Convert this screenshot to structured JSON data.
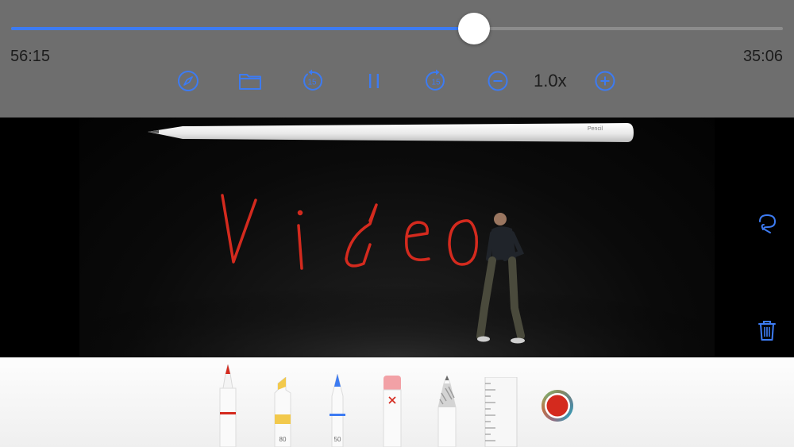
{
  "player": {
    "elapsed": "56:15",
    "remaining": "35:06",
    "progress": 0.6
  },
  "controls": {
    "speed": "1.0x",
    "skip_back_seconds": "15",
    "skip_forward_seconds": "15"
  },
  "video": {
    "pencil_brand": "Pencil"
  },
  "tools": {
    "highlighter_opacity": "80",
    "pen_opacity": "50"
  },
  "colors": {
    "accent": "#3d7bf2",
    "ink": "#d42a1e",
    "highlighter": "#f2c94c"
  },
  "icons": [
    "compass-icon",
    "folder-icon",
    "skip-back-15-icon",
    "pause-icon",
    "skip-forward-15-icon",
    "zoom-out-icon",
    "zoom-in-icon",
    "lasso-icon",
    "trash-icon"
  ]
}
